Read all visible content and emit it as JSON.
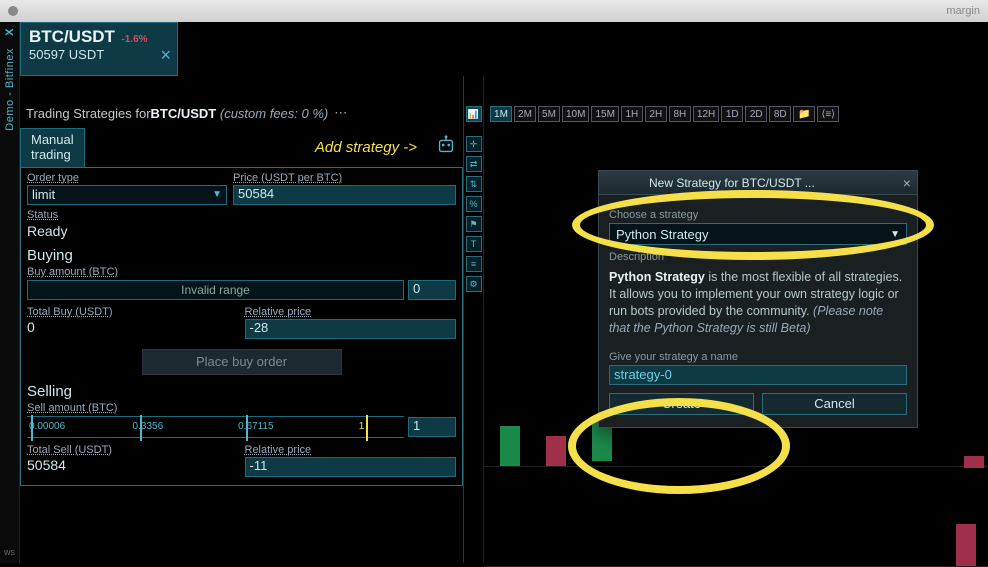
{
  "window": {
    "title": "margin"
  },
  "sidebar": {
    "exchange": "Demo - Bitfinex",
    "x": "X",
    "ws": "ws"
  },
  "pair": {
    "symbol": "BTC/USDT",
    "change": "-1.6%",
    "price": "50597 USDT"
  },
  "strategies": {
    "title_prefix": "Trading Strategies for ",
    "title_pair": "BTC/USDT",
    "fees": "(custom fees: 0 %)",
    "add_hint": "Add strategy ->",
    "tab": "Manual\ntrading"
  },
  "order": {
    "order_type_lbl": "Order type",
    "order_type": "limit",
    "price_lbl": "Price (USDT per BTC)",
    "price": "50584",
    "status_lbl": "Status",
    "status": "Ready",
    "buying": "Buying",
    "buy_amount_lbl": "Buy amount (BTC)",
    "buy_range_text": "Invalid range",
    "buy_range_val": "0",
    "total_buy_lbl": "Total Buy (USDT)",
    "total_buy": "0",
    "rel_price_lbl": "Relative price",
    "rel_price_buy": "-28",
    "place_buy": "Place buy order",
    "selling": "Selling",
    "sell_amount_lbl": "Sell amount (BTC)",
    "sell_ticks": [
      "0.00006",
      "0.3356",
      "0.67115",
      "1"
    ],
    "sell_val": "1",
    "total_sell_lbl": "Total Sell (USDT)",
    "total_sell": "50584",
    "rel_price_sell": "-11"
  },
  "timeframes": [
    "1M",
    "2M",
    "5M",
    "10M",
    "15M",
    "1H",
    "2H",
    "8H",
    "12H",
    "1D",
    "2D",
    "8D"
  ],
  "toolbar_icons": [
    "candlestick",
    "crosshair",
    "horiz-line",
    "arrows",
    "percent",
    "flag",
    "text",
    "layers",
    "settings"
  ],
  "dialog": {
    "title": "New Strategy for BTC/USDT ...",
    "choose_lbl": "Choose a strategy",
    "strategy": "Python Strategy",
    "desc_lbl": "Description",
    "desc_bold": "Python Strategy",
    "desc_rest": " is the most flexible of all strategies. It allows you to implement your own strategy logic or run bots provided by the community. ",
    "desc_note": "(Please note that the Python Strategy is still Beta)",
    "name_lbl": "Give your strategy a name",
    "name": "strategy-0",
    "create": "Create",
    "cancel": "Cancel"
  },
  "colors": {
    "accent": "#4fb8cc",
    "highlight": "#f5e04a",
    "red": "#d84a5a"
  }
}
